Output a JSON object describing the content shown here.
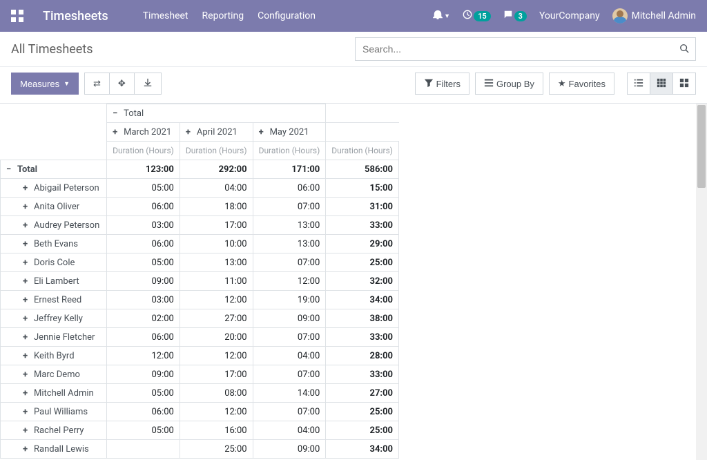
{
  "navbar": {
    "brand": "Timesheets",
    "menu": [
      "Timesheet",
      "Reporting",
      "Configuration"
    ],
    "activity_badge": "15",
    "discuss_badge": "3",
    "company": "YourCompany",
    "user": "Mitchell Admin"
  },
  "view": {
    "title": "All Timesheets",
    "search_placeholder": "Search..."
  },
  "toolbar": {
    "measures": "Measures",
    "filters": "Filters",
    "groupby": "Group By",
    "favorites": "Favorites"
  },
  "pivot": {
    "total_label": "Total",
    "columns": [
      "March 2021",
      "April 2021",
      "May 2021"
    ],
    "measure_label": "Duration (Hours)",
    "grand_total": {
      "march": "123:00",
      "april": "292:00",
      "may": "171:00",
      "total": "586:00"
    },
    "rows": [
      {
        "label": "Abigail Peterson",
        "march": "05:00",
        "april": "04:00",
        "may": "06:00",
        "total": "15:00"
      },
      {
        "label": "Anita Oliver",
        "march": "06:00",
        "april": "18:00",
        "may": "07:00",
        "total": "31:00"
      },
      {
        "label": "Audrey Peterson",
        "march": "03:00",
        "april": "17:00",
        "may": "13:00",
        "total": "33:00"
      },
      {
        "label": "Beth Evans",
        "march": "06:00",
        "april": "10:00",
        "may": "13:00",
        "total": "29:00"
      },
      {
        "label": "Doris Cole",
        "march": "05:00",
        "april": "13:00",
        "may": "07:00",
        "total": "25:00"
      },
      {
        "label": "Eli Lambert",
        "march": "09:00",
        "april": "11:00",
        "may": "12:00",
        "total": "32:00"
      },
      {
        "label": "Ernest Reed",
        "march": "03:00",
        "april": "12:00",
        "may": "19:00",
        "total": "34:00"
      },
      {
        "label": "Jeffrey Kelly",
        "march": "02:00",
        "april": "27:00",
        "may": "09:00",
        "total": "38:00"
      },
      {
        "label": "Jennie Fletcher",
        "march": "06:00",
        "april": "20:00",
        "may": "07:00",
        "total": "33:00"
      },
      {
        "label": "Keith Byrd",
        "march": "12:00",
        "april": "12:00",
        "may": "04:00",
        "total": "28:00"
      },
      {
        "label": "Marc Demo",
        "march": "09:00",
        "april": "17:00",
        "may": "07:00",
        "total": "33:00"
      },
      {
        "label": "Mitchell Admin",
        "march": "05:00",
        "april": "08:00",
        "may": "14:00",
        "total": "27:00"
      },
      {
        "label": "Paul Williams",
        "march": "06:00",
        "april": "12:00",
        "may": "07:00",
        "total": "25:00"
      },
      {
        "label": "Rachel Perry",
        "march": "05:00",
        "april": "16:00",
        "may": "04:00",
        "total": "25:00"
      },
      {
        "label": "Randall Lewis",
        "march": "",
        "april": "25:00",
        "may": "09:00",
        "total": "34:00"
      }
    ]
  }
}
